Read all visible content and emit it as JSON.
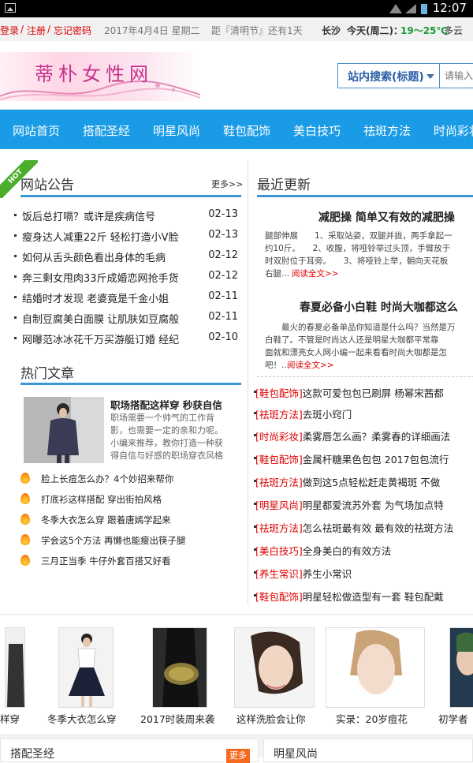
{
  "status_bar": {
    "time": "12:07",
    "icons": [
      "image-icon",
      "wifi-icon",
      "signal-icon",
      "battery-icon"
    ]
  },
  "top_bar": {
    "login": "登录",
    "sep1": "/",
    "register": "注册",
    "sep2": "/",
    "forgot": "忘记密码",
    "date": "2017年4月4日 星期二",
    "countdown": "距『清明节』还有1天",
    "city": "长沙",
    "weather_prefix": "今天(周二)：",
    "temp": "19～25℃",
    "weather": "多云"
  },
  "header": {
    "logo_text": "蒂朴女性网",
    "search_select": "站内搜索(标题)",
    "search_placeholder": "请输入"
  },
  "nav": {
    "items": [
      "网站首页",
      "搭配圣经",
      "明星风尚",
      "包配饰",
      "美白技巧",
      "祛斑方法",
      "时尚彩妆"
    ],
    "items_full": [
      "网站首页",
      "搭配圣经",
      "明星风尚",
      "鞋包配饰",
      "美白技巧",
      "祛斑方法",
      "时尚彩妆"
    ]
  },
  "notice": {
    "ribbon": "HOT",
    "title": "网站公告",
    "more": "更多>>",
    "items": [
      {
        "text": "饭后总打嗝？或许是疾病信号",
        "date": "02-13"
      },
      {
        "text": "瘦身达人减重22斤 轻松打造小V脸",
        "date": "02-13"
      },
      {
        "text": "如何从舌头颜色看出身体的毛病",
        "date": "02-12"
      },
      {
        "text": "奔三剩女甩肉33斤成婚恋网抢手货",
        "date": "02-12"
      },
      {
        "text": "结婚时才发现 老婆竟是千金小姐",
        "date": "02-11"
      },
      {
        "text": "自制豆腐美白面膜 让肌肤如豆腐般",
        "date": "02-11"
      },
      {
        "text": "网曝范冰冰花千万买游艇订婚 经纪",
        "date": "02-10"
      }
    ]
  },
  "hot": {
    "title": "热门文章",
    "feature_title": "职场搭配这样穿 秒获自信",
    "feature_lines": [
      "职场需要一个帅气的工作背",
      "影，也需要一定的亲和力呢。",
      "小编来推荐，教你打造一种获",
      "得自信与好感的职场穿衣风格"
    ],
    "items": [
      "脸上长痘怎么办？4个妙招来帮你",
      "打底衫这样搭配 穿出街拍风格",
      "冬季大衣怎么穿 跟着唐嫣学起来",
      "学会这5个方法 再懒也能瘦出筷子腿",
      "三月正当季 牛仔外套百搭又好看"
    ]
  },
  "latest": {
    "title": "最近更新",
    "article1": {
      "title": "减肥操 简单又有效的减肥操",
      "lines": [
        "腿部伸展　　1、采取站姿，双腿并拢，两手拿起一",
        "约10斤。　　2、收腹，将哑铃举过头顶，手臂放于",
        "时双肘位于耳旁。　　3、将哑铃上举，朝向天花板",
        "右腿..."
      ],
      "readmore": "阅读全文>>"
    },
    "article2": {
      "title": "春夏必备小白鞋 时尚大咖都这么",
      "lines": [
        "　　最火的春夏必备单品你知道是什么吗？当然是万",
        "白鞋了。不管是时尚达人还是明星大咖都平常靠",
        "面就和漂亮女人网小编一起来看看时尚大咖都是怎",
        "吧！..."
      ],
      "readmore": "阅读全文>>"
    },
    "items": [
      {
        "cat": "[鞋包配饰]",
        "text": "这款可爱包包已刷屏 杨幂宋茜都"
      },
      {
        "cat": "[祛斑方法]",
        "text": "去斑小窍门"
      },
      {
        "cat": "[时尚彩妆]",
        "text": "柔雾唇怎么画？柔雾春的详细画法"
      },
      {
        "cat": "[鞋包配饰]",
        "text": "金属杆糖果色包包 2017包包流行"
      },
      {
        "cat": "[祛斑方法]",
        "text": "做到这5点轻松赶走黄褐斑 不做"
      },
      {
        "cat": "[明星风尚]",
        "text": "明星都爱流苏外套 为气场加点特"
      },
      {
        "cat": "[祛斑方法]",
        "text": "怎么祛斑最有效 最有效的祛斑方法"
      },
      {
        "cat": "[美白技巧]",
        "text": "全身美白的有效方法"
      },
      {
        "cat": "[养生常识]",
        "text": "养生小常识"
      },
      {
        "cat": "[鞋包配饰]",
        "text": "明星轻松做造型有一套 鞋包配戴"
      }
    ]
  },
  "gallery": {
    "captions": [
      "样穿",
      "冬季大衣怎么穿",
      "2017时装周来袭",
      "这样洗脸会让你",
      "实录：20岁痘花",
      "初学者"
    ]
  },
  "bottom": {
    "left_title": "搭配圣经",
    "left_more": "更多",
    "right_title": "明星风尚"
  },
  "colors": {
    "nav_blue": "#1a9be6",
    "accent_red": "#dd0000",
    "hot_green": "#4cae2c",
    "more_orange": "#f56a1e"
  }
}
